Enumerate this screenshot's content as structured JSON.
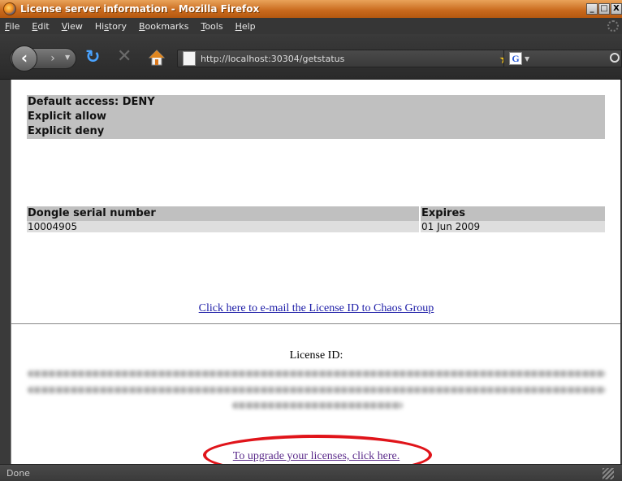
{
  "window": {
    "title": "License server information - Mozilla Firefox",
    "min_label": "_",
    "max_label": "□",
    "close_label": "X"
  },
  "menu": {
    "items": [
      {
        "acc": "F",
        "rest": "ile"
      },
      {
        "acc": "E",
        "rest": "dit"
      },
      {
        "acc": "V",
        "rest": "iew"
      },
      {
        "pre": "Hi",
        "acc": "s",
        "rest": "tory"
      },
      {
        "acc": "B",
        "rest": "ookmarks"
      },
      {
        "acc": "T",
        "rest": "ools"
      },
      {
        "acc": "H",
        "rest": "elp"
      }
    ]
  },
  "nav": {
    "url": "http://localhost:30304/getstatus",
    "search_engine": "G"
  },
  "acl": {
    "rows": [
      "Default access: DENY",
      "Explicit allow",
      "Explicit deny"
    ]
  },
  "dongle": {
    "headers": {
      "serial": "Dongle serial number",
      "expires": "Expires"
    },
    "rows": [
      {
        "serial": "10004905",
        "expires": "01 Jun 2009"
      }
    ]
  },
  "email_link": "Click here to e-mail the License ID to Chaos Group",
  "license_id_label": "License ID:",
  "upgrade_link": "To upgrade your licenses, click here.",
  "status": "Done",
  "colors": {
    "link": "#1a1aa6",
    "visited_link": "#5a2a8a",
    "highlight": "#e0141a",
    "title_bar": "#c8691c"
  },
  "icons": [
    "firefox-icon",
    "back-icon",
    "forward-icon",
    "reload-icon",
    "stop-icon",
    "home-icon",
    "page-icon",
    "bookmark-star-icon",
    "google-icon",
    "search-icon",
    "throbber-icon",
    "resize-grip-icon"
  ]
}
